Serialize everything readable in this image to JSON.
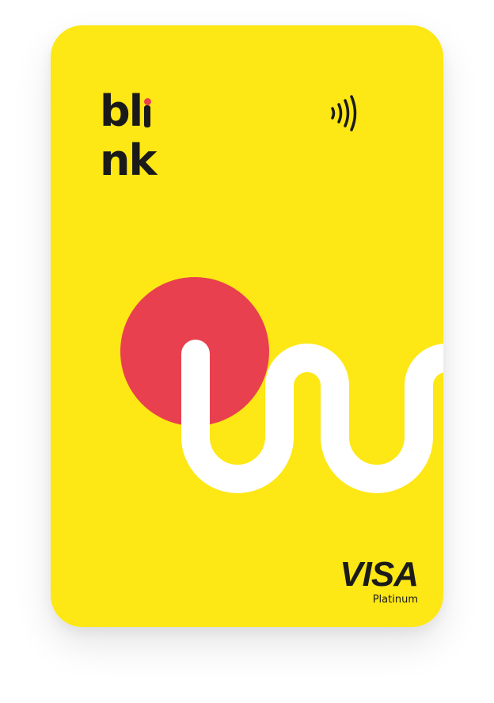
{
  "card": {
    "brand": {
      "name": "blink",
      "prefix": "bl",
      "suffix": "nk",
      "dot_color": "#e8404f"
    },
    "contactless_icon": "contactless-icon",
    "network": {
      "name": "VISA",
      "tier": "Platinum"
    },
    "colors": {
      "background": "#fde714",
      "circle": "#e8404f",
      "wave": "#ffffff",
      "text": "#1b1b1b"
    }
  }
}
